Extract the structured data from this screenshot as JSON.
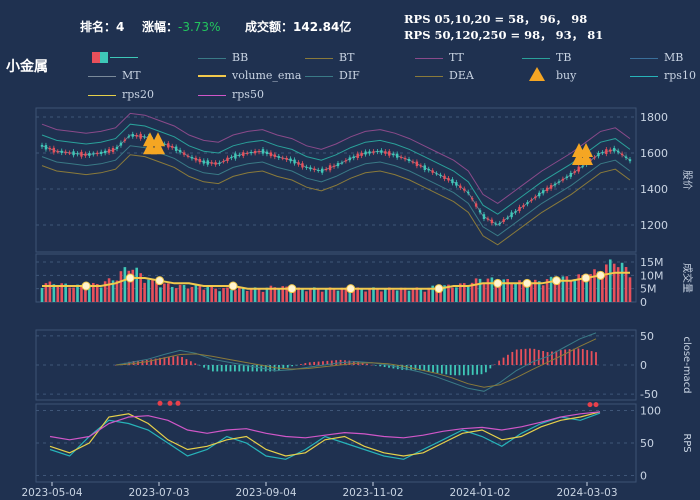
{
  "header": {
    "rank_label": "排名：",
    "rank_value": "4",
    "change_label": "涨幅：",
    "change_value": "-3.73%",
    "turnover_label": "成交额：",
    "turnover_value": "142.84亿",
    "rps_line1": "RPS 05,10,20 = 58， 96， 98",
    "rps_line2": "RPS 50,120,250 = 98， 93， 81"
  },
  "stock_name": "小金属",
  "colors": {
    "bg": "#1f3150",
    "up": "#e8505b",
    "down": "#3ec8b8",
    "ema": "#f2c94c",
    "rps20": "#e6d04a",
    "rps50": "#d057c8",
    "rps10": "#27b3b9",
    "buy": "#f5a623"
  },
  "legend": [
    {
      "key": "candle",
      "label": "",
      "icon": "candle-swatch-icon"
    },
    {
      "key": "BB",
      "label": "BB",
      "color": "#3a7a86"
    },
    {
      "key": "BT",
      "label": "BT",
      "color": "#8a7a3a"
    },
    {
      "key": "TT",
      "label": "TT",
      "color": "#8a4a8a"
    },
    {
      "key": "TB",
      "label": "TB",
      "color": "#2aa19a"
    },
    {
      "key": "MB",
      "label": "MB",
      "color": "#3a6f9a"
    },
    {
      "key": "MT",
      "label": "MT",
      "color": "#7a8a9a"
    },
    {
      "key": "volume_ema",
      "label": "volume_ema",
      "color": "#f2c94c"
    },
    {
      "key": "DIF",
      "label": "DIF",
      "color": "#3a7a86"
    },
    {
      "key": "DEA",
      "label": "DEA",
      "color": "#8a7a3a"
    },
    {
      "key": "buy",
      "label": "buy",
      "icon": "buy-triangle-icon"
    },
    {
      "key": "rps10",
      "label": "rps10",
      "color": "#27b3b9"
    },
    {
      "key": "rps20",
      "label": "rps20",
      "color": "#e6d04a"
    },
    {
      "key": "rps50",
      "label": "rps50",
      "color": "#d057c8"
    }
  ],
  "chart_data": {
    "type": "line",
    "x_ticks": [
      "2023-05-04",
      "2023-07-03",
      "2023-09-04",
      "2023-11-02",
      "2024-01-02",
      "2024-03-03"
    ],
    "panels": [
      {
        "name": "price",
        "ylabel": "股价",
        "yticks": [
          "1200",
          "1400",
          "1600",
          "1800"
        ],
        "ylim": [
          1050,
          1850
        ],
        "series": [
          {
            "name": "close",
            "values": [
              1640,
              1610,
              1600,
              1590,
              1600,
              1620,
              1700,
              1690,
              1660,
              1630,
              1580,
              1550,
              1540,
              1580,
              1600,
              1610,
              1580,
              1560,
              1520,
              1500,
              1530,
              1570,
              1600,
              1610,
              1590,
              1560,
              1520,
              1480,
              1440,
              1380,
              1250,
              1200,
              1260,
              1320,
              1380,
              1430,
              1480,
              1540,
              1600,
              1620,
              1560
            ]
          }
        ]
      },
      {
        "name": "volume",
        "ylabel": "成交量",
        "yticks": [
          "0",
          "5M",
          "10M",
          "15M"
        ],
        "ylim": [
          0,
          18
        ],
        "series": [
          {
            "name": "volume",
            "values": [
              7,
              7,
              6,
              6,
              7,
              9,
              14,
              9,
              7,
              6,
              6,
              6,
              5,
              5,
              5,
              5,
              6,
              5,
              5,
              5,
              5,
              5,
              5,
              5,
              5,
              5,
              5,
              6,
              6,
              7,
              9,
              8,
              8,
              7,
              8,
              9,
              9,
              10,
              12,
              16,
              11
            ]
          },
          {
            "name": "volume_ema",
            "values": [
              6,
              6,
              6,
              6,
              6,
              7,
              9,
              9,
              8,
              7,
              7,
              6,
              6,
              6,
              5,
              5,
              5,
              5,
              5,
              5,
              5,
              5,
              5,
              5,
              5,
              5,
              5,
              5,
              6,
              6,
              7,
              7,
              7,
              7,
              7,
              8,
              8,
              9,
              10,
              11,
              11
            ]
          }
        ]
      },
      {
        "name": "macd",
        "ylabel": "close-macd",
        "yticks": [
          "-50",
          "0",
          "50"
        ],
        "ylim": [
          -60,
          60
        ],
        "series": [
          {
            "name": "DIF",
            "values": [
              0,
              5,
              10,
              18,
              25,
              20,
              10,
              5,
              0,
              -5,
              -10,
              -8,
              -4,
              0,
              4,
              6,
              4,
              0,
              -6,
              -12,
              -20,
              -30,
              -40,
              -45,
              -30,
              -10,
              5,
              15,
              30,
              45,
              55
            ]
          },
          {
            "name": "DEA",
            "values": [
              0,
              2,
              6,
              12,
              18,
              19,
              15,
              10,
              5,
              0,
              -5,
              -7,
              -6,
              -3,
              0,
              3,
              4,
              2,
              -2,
              -8,
              -14,
              -22,
              -32,
              -38,
              -34,
              -22,
              -8,
              5,
              18,
              32,
              45
            ]
          }
        ]
      },
      {
        "name": "rps",
        "ylabel": "RPS",
        "yticks": [
          "0",
          "50",
          "100"
        ],
        "ylim": [
          -10,
          110
        ],
        "series": [
          {
            "name": "rps10",
            "values": [
              40,
              30,
              60,
              85,
              80,
              70,
              50,
              30,
              40,
              60,
              50,
              30,
              25,
              40,
              60,
              50,
              40,
              30,
              25,
              40,
              55,
              70,
              60,
              45,
              65,
              80,
              90,
              85,
              96
            ]
          },
          {
            "name": "rps20",
            "values": [
              45,
              35,
              50,
              90,
              95,
              80,
              55,
              40,
              45,
              55,
              60,
              40,
              30,
              35,
              55,
              60,
              45,
              35,
              30,
              35,
              50,
              65,
              70,
              55,
              60,
              75,
              85,
              90,
              98
            ]
          },
          {
            "name": "rps50",
            "values": [
              60,
              55,
              60,
              80,
              90,
              92,
              85,
              70,
              65,
              70,
              72,
              65,
              60,
              58,
              62,
              66,
              64,
              60,
              58,
              62,
              68,
              72,
              74,
              70,
              75,
              82,
              90,
              95,
              98
            ]
          }
        ]
      }
    ]
  }
}
